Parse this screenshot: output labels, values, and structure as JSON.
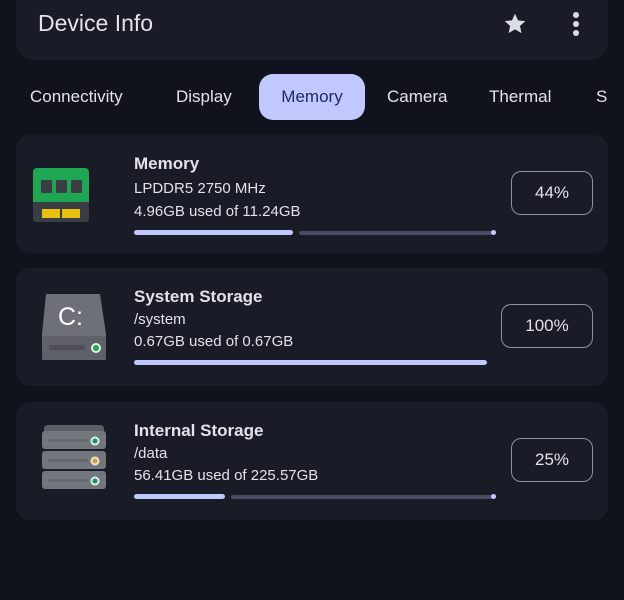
{
  "app": {
    "title": "Device Info",
    "actions": [
      {
        "icon": "star-icon",
        "label": "Favorite"
      },
      {
        "icon": "more-vert-icon",
        "label": "More options"
      }
    ]
  },
  "tabs": [
    {
      "label": "Connectivity",
      "active": false
    },
    {
      "label": "Display",
      "active": false
    },
    {
      "label": "Memory",
      "active": true
    },
    {
      "label": "Camera",
      "active": false
    },
    {
      "label": "Thermal",
      "active": false
    },
    {
      "label": "S",
      "active": false
    }
  ],
  "cards": [
    {
      "icon": "ram-chip-icon",
      "title": "Memory",
      "subtitle": "LPDDR5 2750 MHz",
      "usage": "4.96GB used of 11.24GB",
      "percent_label": "44%",
      "progress": 0.44
    },
    {
      "icon": "drive-c-icon",
      "title": "System Storage",
      "subtitle": "/system",
      "usage": "0.67GB used of 0.67GB",
      "percent_label": "100%",
      "progress": 1.0
    },
    {
      "icon": "server-stack-icon",
      "title": "Internal Storage",
      "subtitle": "/data",
      "usage": "56.41GB used of 225.57GB",
      "percent_label": "25%",
      "progress": 0.25
    }
  ],
  "colors": {
    "background": "#11131c",
    "surface": "#191b26",
    "accent": "#c0c8ff",
    "accent_text": "#1c2b66",
    "track": "#4b4a66",
    "text": "#e3e2ea"
  }
}
